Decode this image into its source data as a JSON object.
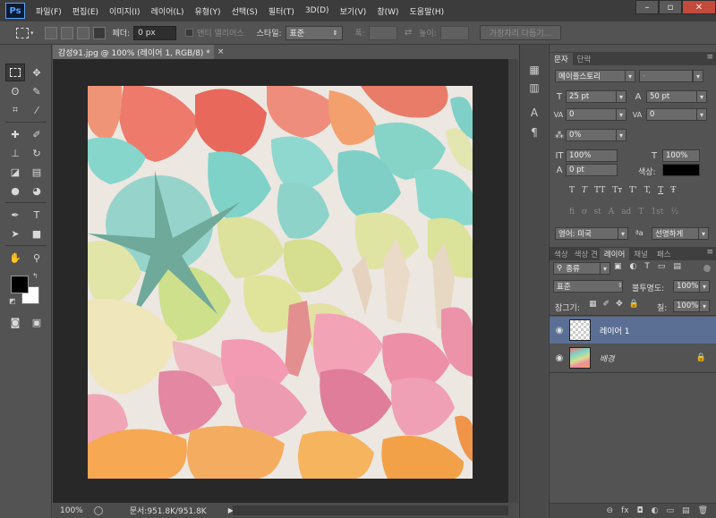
{
  "app": {
    "logo": "Ps"
  },
  "menu": [
    "파일(F)",
    "편집(E)",
    "이미지(I)",
    "레이어(L)",
    "유형(Y)",
    "선택(S)",
    "필터(T)",
    "3D(D)",
    "보기(V)",
    "창(W)",
    "도움말(H)"
  ],
  "window_controls": {
    "minimize": "–",
    "restore": "▫",
    "close": "✕"
  },
  "options_bar": {
    "feather_label": "페더:",
    "feather_value": "0 px",
    "antialias_label": "앤티 앨리어스",
    "style_label": "스타일:",
    "style_value": "표준",
    "width_label": "폭:",
    "height_label": "높이:",
    "refine_edge_button": "가장자리 다듬기..."
  },
  "document": {
    "tab_title": "감성91.jpg @ 100% (레이어 1, RGB/8) *",
    "tab_close": "×",
    "zoom": "100%",
    "doc_info": "문서:951.8K/951.8K"
  },
  "character_panel": {
    "tabs": [
      "문자",
      "단락"
    ],
    "font_family": "메이플스토리",
    "font_style": "-",
    "font_size": "25 pt",
    "leading": "50 pt",
    "kerning": "0",
    "tracking": "0",
    "vertical_scale_pct": "0%",
    "vertical_scale": "100%",
    "horizontal_scale": "100%",
    "baseline_shift": "0 pt",
    "color_label": "색상:",
    "color_value": "#000000",
    "style_buttons": [
      "T",
      "T",
      "TT",
      "Tт",
      "T'",
      "T,",
      "T",
      "Ŧ"
    ],
    "opentype_buttons": [
      "fi",
      "ơ",
      "st",
      "A",
      "ad",
      "T",
      "1st",
      "½"
    ],
    "language": "영어: 미국",
    "aa_label": "ªa",
    "antialias": "선명하게"
  },
  "layers_panel": {
    "tabs": [
      "색상",
      "색상 견",
      "레이어",
      "채널",
      "패스"
    ],
    "filter_kind": "종류",
    "blend_mode": "표준",
    "opacity_label": "불투명도:",
    "opacity": "100%",
    "lock_label": "잠그기:",
    "fill_label": "칠:",
    "fill": "100%",
    "layers": [
      {
        "name": "레이어 1",
        "selected": true
      },
      {
        "name": "배경",
        "selected": false
      }
    ],
    "bottom_icons": [
      "⊖",
      "fx",
      "◘",
      "◐",
      "▭",
      "▤",
      "🗑"
    ]
  },
  "colors": {
    "foreground": "#000000",
    "background": "#ffffff",
    "selected_layer": "#5a6f93"
  }
}
